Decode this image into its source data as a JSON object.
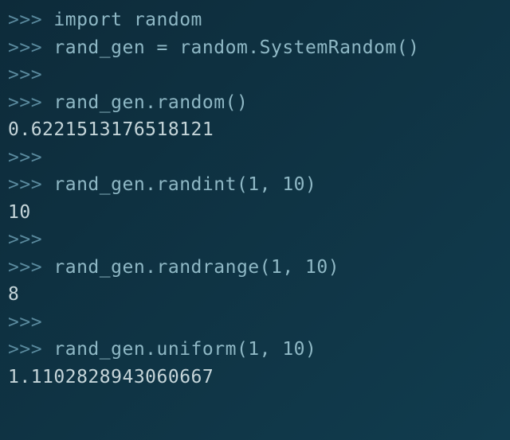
{
  "lines": [
    {
      "prompt": ">>> ",
      "code": "import random",
      "output": ""
    },
    {
      "prompt": ">>> ",
      "code": "rand_gen = random.SystemRandom()",
      "output": ""
    },
    {
      "prompt": ">>>",
      "code": "",
      "output": ""
    },
    {
      "prompt": ">>> ",
      "code": "rand_gen.random()",
      "output": ""
    },
    {
      "prompt": "",
      "code": "",
      "output": "0.6221513176518121"
    },
    {
      "prompt": ">>>",
      "code": "",
      "output": ""
    },
    {
      "prompt": ">>> ",
      "code": "rand_gen.randint(1, 10)",
      "output": ""
    },
    {
      "prompt": "",
      "code": "",
      "output": "10"
    },
    {
      "prompt": ">>>",
      "code": "",
      "output": ""
    },
    {
      "prompt": ">>> ",
      "code": "rand_gen.randrange(1, 10)",
      "output": ""
    },
    {
      "prompt": "",
      "code": "",
      "output": "8"
    },
    {
      "prompt": ">>>",
      "code": "",
      "output": ""
    },
    {
      "prompt": ">>> ",
      "code": "rand_gen.uniform(1, 10)",
      "output": ""
    },
    {
      "prompt": "",
      "code": "",
      "output": "1.1102828943060667"
    }
  ]
}
